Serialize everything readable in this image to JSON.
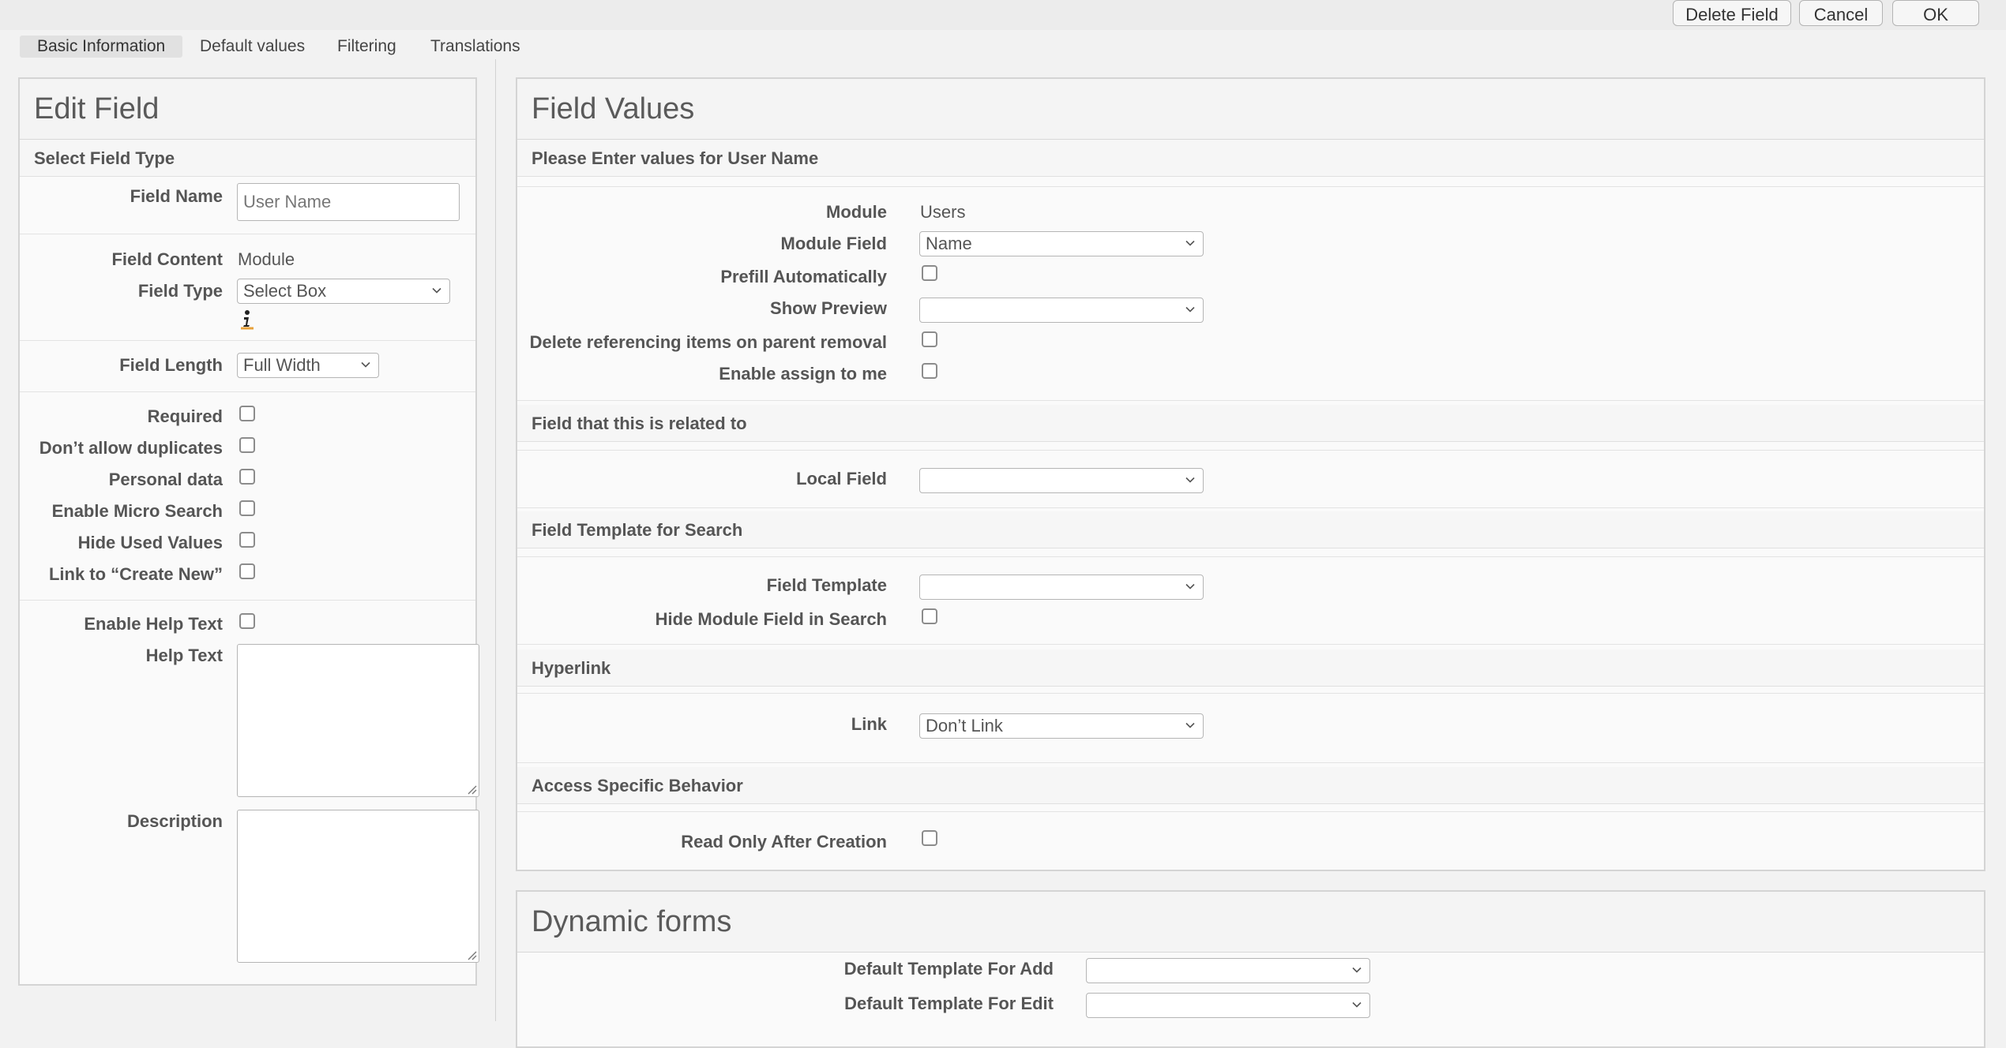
{
  "toolbar": {
    "delete_field": "Delete Field",
    "cancel": "Cancel",
    "ok": "OK"
  },
  "tabs": [
    {
      "label": "Basic Information",
      "active": true
    },
    {
      "label": "Default values",
      "active": false
    },
    {
      "label": "Filtering",
      "active": false
    },
    {
      "label": "Translations",
      "active": false
    }
  ],
  "edit_field": {
    "title": "Edit Field",
    "section": "Select Field Type",
    "field_name_label": "Field Name",
    "field_name_value": "User Name",
    "field_content_label": "Field Content",
    "field_content_value": "Module",
    "field_type_label": "Field Type",
    "field_type_value": "Select Box",
    "field_length_label": "Field Length",
    "field_length_value": "Full Width",
    "checkboxes": [
      {
        "label": "Required",
        "checked": false
      },
      {
        "label": "Don’t allow duplicates",
        "checked": false
      },
      {
        "label": "Personal data",
        "checked": false
      },
      {
        "label": "Enable Micro Search",
        "checked": false
      },
      {
        "label": "Hide Used Values",
        "checked": false
      },
      {
        "label": "Link to “Create New”",
        "checked": false
      }
    ],
    "enable_help_text_label": "Enable Help Text",
    "help_text_label": "Help Text",
    "help_text_value": "",
    "description_label": "Description",
    "description_value": ""
  },
  "field_values": {
    "title": "Field Values",
    "section_values": "Please Enter values for User Name",
    "module_label": "Module",
    "module_value": "Users",
    "module_field_label": "Module Field",
    "module_field_value": "Name",
    "prefill_label": "Prefill Automatically",
    "show_preview_label": "Show Preview",
    "show_preview_value": "",
    "delete_ref_label": "Delete referencing items on parent removal",
    "assign_label": "Enable assign to me",
    "section_related": "Field that this is related to",
    "local_field_label": "Local Field",
    "local_field_value": "",
    "section_template": "Field Template for Search",
    "field_template_label": "Field Template",
    "field_template_value": "",
    "hide_module_field_label": "Hide Module Field in Search",
    "section_hyperlink": "Hyperlink",
    "link_label": "Link",
    "link_value": "Don’t Link",
    "section_access": "Access Specific Behavior",
    "read_only_label": "Read Only After Creation"
  },
  "dynamic_forms": {
    "title": "Dynamic forms",
    "default_add_label": "Default Template For Add",
    "default_add_value": "",
    "default_edit_label": "Default Template For Edit",
    "default_edit_value": ""
  },
  "colors": {
    "background": "#f2f2f2",
    "panel": "#fafafa",
    "border": "#d4d4d4",
    "text": "#555555"
  },
  "icons": [
    "chevron-down-icon",
    "info-icon",
    "resize-grip-icon"
  ]
}
